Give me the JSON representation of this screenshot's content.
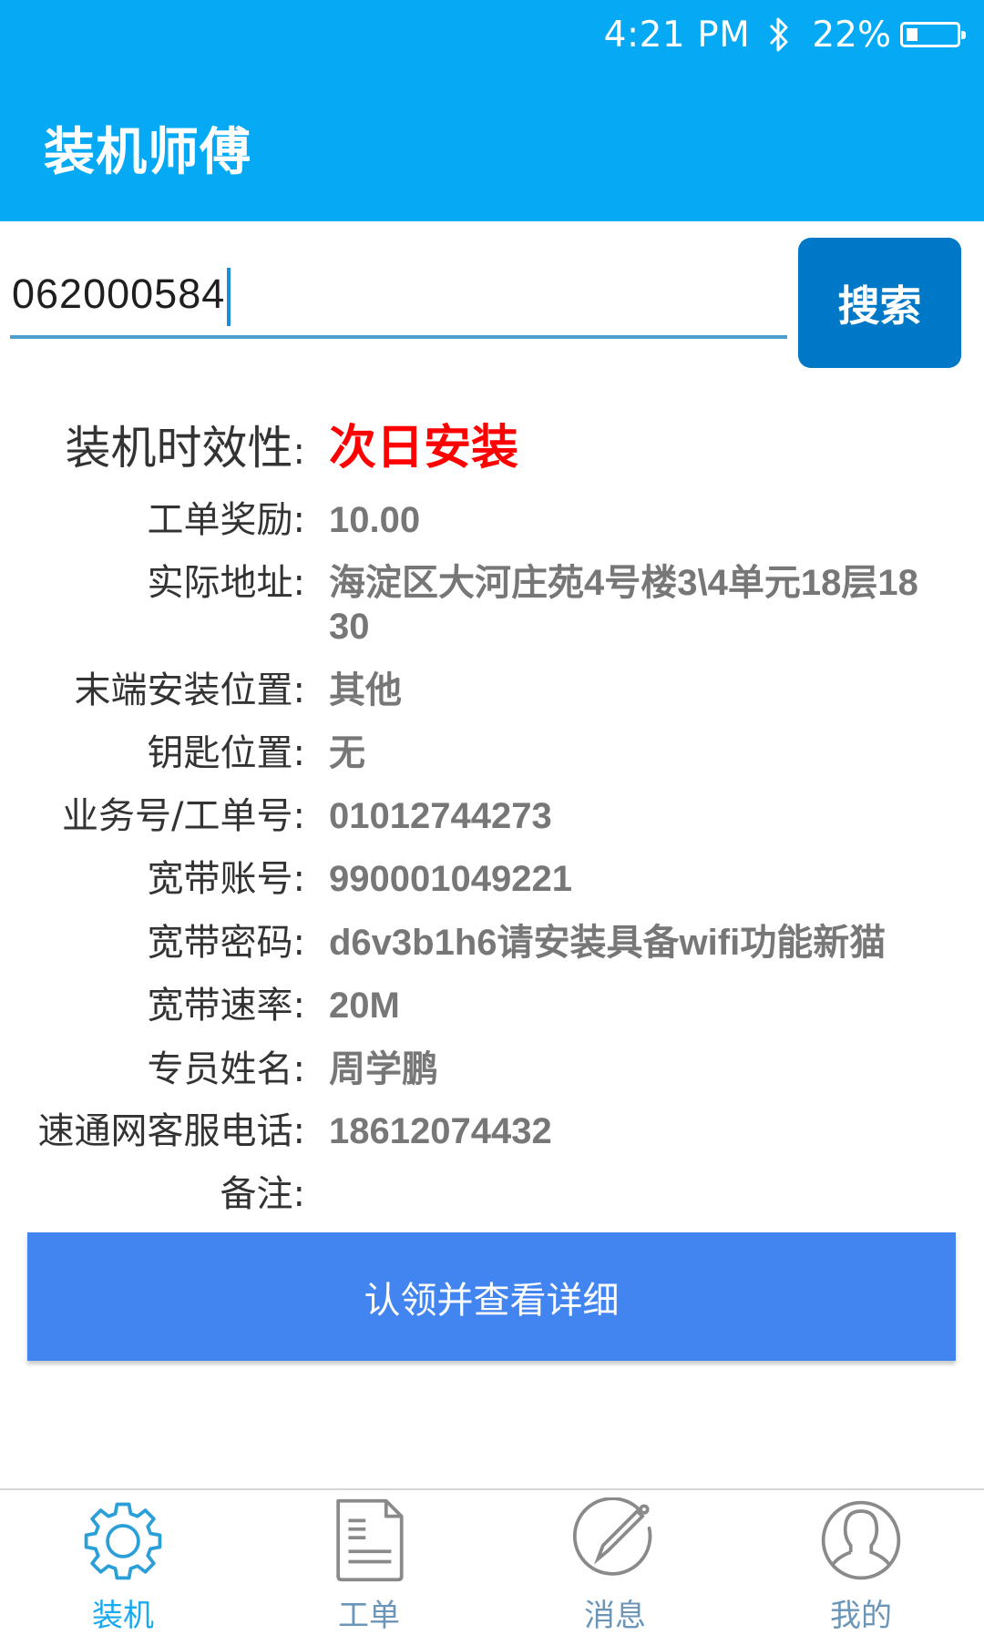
{
  "status_bar": {
    "time": "4:21 PM",
    "bluetooth_icon": "bluetooth-icon",
    "battery_percent": "22%",
    "battery_level": 0.22
  },
  "app_bar": {
    "title": "装机师傅",
    "color": "#05a9f4"
  },
  "search": {
    "value": "062000584",
    "button_label": "搜索"
  },
  "details": [
    {
      "label": "装机时效性",
      "value": "次日安装",
      "highlight": true,
      "highlight_color": "#ff0000"
    },
    {
      "label": "工单奖励",
      "value": "10.00"
    },
    {
      "label": "实际地址",
      "value": "海淀区大河庄苑4号楼3\\4单元18层1830"
    },
    {
      "label": "末端安装位置",
      "value": "其他"
    },
    {
      "label": "钥匙位置",
      "value": "无"
    },
    {
      "label": "业务号/工单号",
      "value": "01012744273"
    },
    {
      "label": "宽带账号",
      "value": "990001049221"
    },
    {
      "label": "宽带密码",
      "value": "d6v3b1h6请安装具备wifi功能新猫"
    },
    {
      "label": "宽带速率",
      "value": "20M"
    },
    {
      "label": "专员姓名",
      "value": "周学鹏"
    },
    {
      "label": "速通网客服电话",
      "value": "18612074432"
    },
    {
      "label": "备注",
      "value": ""
    }
  ],
  "label_separator": ":",
  "claim_button": {
    "label": "认领并查看详细",
    "color": "#4285f0"
  },
  "bottom_nav": [
    {
      "label": "装机",
      "icon": "gear-icon",
      "active": true
    },
    {
      "label": "工单",
      "icon": "document-icon",
      "active": false
    },
    {
      "label": "消息",
      "icon": "pencil-circle-icon",
      "active": false
    },
    {
      "label": "我的",
      "icon": "user-circle-icon",
      "active": false
    }
  ]
}
